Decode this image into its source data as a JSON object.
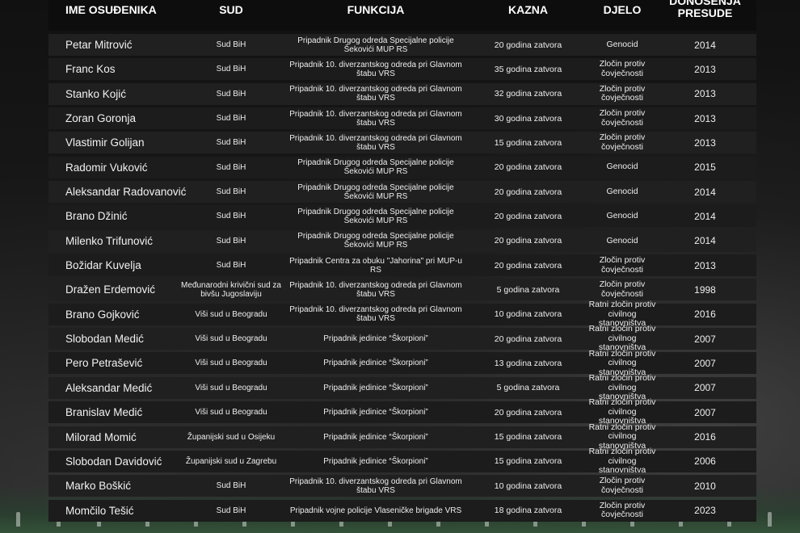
{
  "headers": {
    "name": "IME OSUĐENIKA",
    "court": "SUD",
    "function": "FUNKCIJA",
    "sentence": "KAZNA",
    "crime": "DJELO",
    "year_line1": "DONOŠENJA",
    "year_line2": "PRESUDE"
  },
  "rows": [
    {
      "name": "Petar Mitrović",
      "court": "Sud BiH",
      "function": "Pripadnik Drugog odreda Specijalne policije Šekovići MUP RS",
      "sentence": "20 godina zatvora",
      "crime": "Genocid",
      "year": "2014"
    },
    {
      "name": "Franc Kos",
      "court": "Sud BiH",
      "function": "Pripadnik 10. diverzantskog odreda pri Glavnom štabu VRS",
      "sentence": "35 godina zatvora",
      "crime": "Zločin protiv čovječnosti",
      "year": "2013"
    },
    {
      "name": "Stanko Kojić",
      "court": "Sud BiH",
      "function": "Pripadnik 10. diverzantskog odreda pri Glavnom štabu VRS",
      "sentence": "32 godina zatvora",
      "crime": "Zločin protiv čovječnosti",
      "year": "2013"
    },
    {
      "name": "Zoran Goronja",
      "court": "Sud BiH",
      "function": "Pripadnik 10. diverzantskog odreda pri Glavnom štabu VRS",
      "sentence": "30 godina zatvora",
      "crime": "Zločin protiv čovječnosti",
      "year": "2013"
    },
    {
      "name": "Vlastimir Golijan",
      "court": "Sud BiH",
      "function": "Pripadnik 10. diverzantskog odreda pri Glavnom štabu VRS",
      "sentence": "15 godina zatvora",
      "crime": "Zločin protiv čovječnosti",
      "year": "2013"
    },
    {
      "name": "Radomir Vuković",
      "court": "Sud BiH",
      "function": "Pripadnik Drugog odreda Specijalne policije Šekovići MUP RS",
      "sentence": "20 godina zatvora",
      "crime": "Genocid",
      "year": "2015"
    },
    {
      "name": "Aleksandar Radovanović",
      "court": "Sud BiH",
      "function": "Pripadnik Drugog odreda Specijalne policije Šekovići MUP RS",
      "sentence": "20 godina zatvora",
      "crime": "Genocid",
      "year": "2014"
    },
    {
      "name": "Brano Džinić",
      "court": "Sud BiH",
      "function": "Pripadnik Drugog odreda Specijalne policije Šekovići MUP RS",
      "sentence": "20 godina zatvora",
      "crime": "Genocid",
      "year": "2014"
    },
    {
      "name": "Milenko Trifunović",
      "court": "Sud BiH",
      "function": "Pripadnik Drugog odreda Specijalne policije Šekovići MUP RS",
      "sentence": "20 godina zatvora",
      "crime": "Genocid",
      "year": "2014"
    },
    {
      "name": "Božidar Kuvelja",
      "court": "Sud BiH",
      "function": "Pripadnik Centra za obuku \"Jahorina\" pri MUP-u RS",
      "sentence": "20 godina zatvora",
      "crime": "Zločin protiv čovječnosti",
      "year": "2013"
    },
    {
      "name": "Dražen Erdemović",
      "court": "Međunarodni krivični sud za bivšu Jugoslaviju",
      "function": "Pripadnik 10. diverzantskog odreda pri Glavnom štabu VRS",
      "sentence": "5 godina zatvora",
      "crime": "Zločin protiv čovječnosti",
      "year": "1998"
    },
    {
      "name": "Brano Gojković",
      "court": "Viši sud u Beogradu",
      "function": "Pripadnik 10. diverzantskog odreda pri Glavnom štabu VRS",
      "sentence": "10 godina zatvora",
      "crime": "Ratni zločin protiv civilnog stanovništva",
      "year": "2016"
    },
    {
      "name": "Slobodan Medić",
      "court": "Viši sud u Beogradu",
      "function": "Pripadnik jedinice “Škorpioni”",
      "sentence": "20 godina zatvora",
      "crime": "Ratni zločin protiv civilnog stanovništva",
      "year": "2007"
    },
    {
      "name": "Pero Petrašević",
      "court": "Viši sud u Beogradu",
      "function": "Pripadnik jedinice “Škorpioni”",
      "sentence": "13 godina zatvora",
      "crime": "Ratni zločin protiv civilnog stanovništva",
      "year": "2007"
    },
    {
      "name": "Aleksandar Medić",
      "court": "Viši sud u Beogradu",
      "function": "Pripadnik jedinice “Škorpioni”",
      "sentence": "5 godina zatvora",
      "crime": "Ratni zločin protiv civilnog stanovništva",
      "year": "2007"
    },
    {
      "name": "Branislav Medić",
      "court": "Viši sud u Beogradu",
      "function": "Pripadnik jedinice “Škorpioni”",
      "sentence": "20 godina zatvora",
      "crime": "Ratni zločin protiv civilnog stanovništva",
      "year": "2007"
    },
    {
      "name": "Milorad Momić",
      "court": "Županijski sud u Osijeku",
      "function": "Pripadnik jedinice “Škorpioni”",
      "sentence": "15 godina zatvora",
      "crime": "Ratni zločin protiv civilnog stanovništva",
      "year": "2016"
    },
    {
      "name": "Slobodan Davidović",
      "court": "Županijski sud u Zagrebu",
      "function": "Pripadnik jedinice “Škorpioni”",
      "sentence": "15 godina zatvora",
      "crime": "Ratni zločin protiv civilnog stanovništva",
      "year": "2006"
    },
    {
      "name": "Marko Boškić",
      "court": "Sud BiH",
      "function": "Pripadnik 10. diverzantskog odreda pri Glavnom štabu VRS",
      "sentence": "10 godina zatvora",
      "crime": "Zločin protiv čovječnosti",
      "year": "2010"
    },
    {
      "name": "Momčilo Tešić",
      "court": "Sud BiH",
      "function": "Pripadnik vojne policije Vlaseničke brigade VRS",
      "sentence": "18 godina zatvora",
      "crime": "Zločin protiv čovječnosti",
      "year": "2023"
    }
  ]
}
